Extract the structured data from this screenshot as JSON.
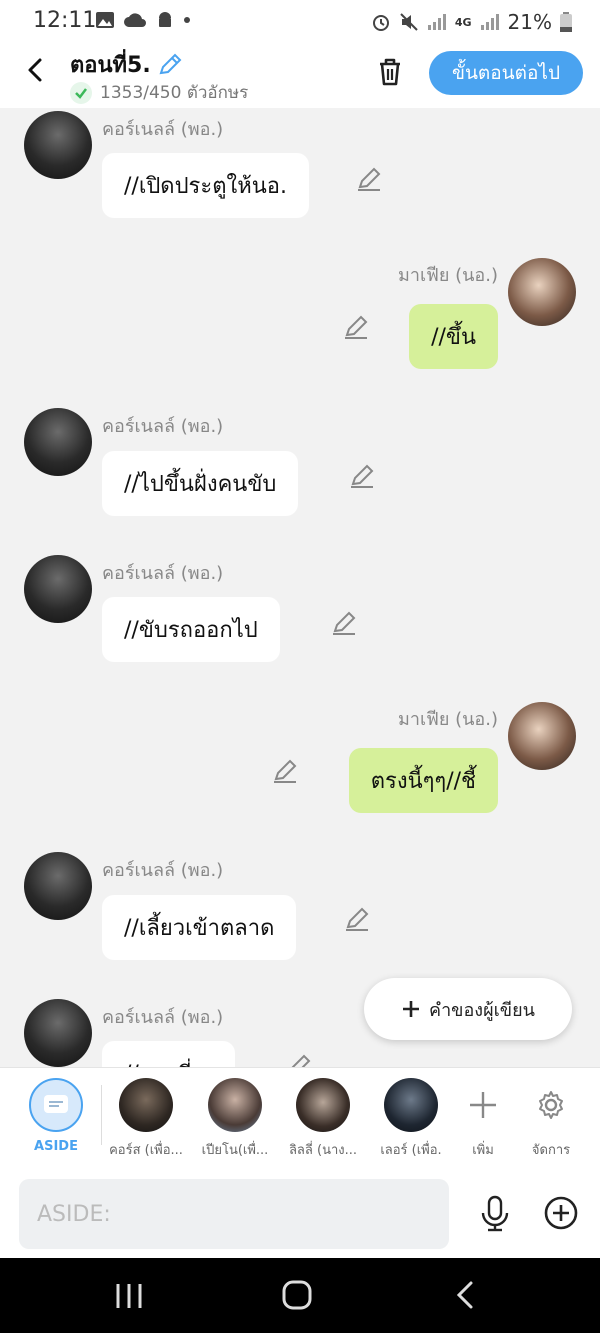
{
  "status": {
    "time": "12:11",
    "battery": "21%",
    "network": "4G"
  },
  "header": {
    "title": "ตอนที่5.",
    "count": "1353/450 ตัวอักษร",
    "next_label": "ขั้นตอนต่อไป"
  },
  "messages": [
    {
      "side": "left",
      "name": "คอร์เนลล์ (พอ.)",
      "text": "//เปิดประตูให้นอ."
    },
    {
      "side": "right",
      "name": "มาเฟีย (นอ.)",
      "text": "//ขึ้น"
    },
    {
      "side": "left",
      "name": "คอร์เนลล์ (พอ.)",
      "text": "//ไปขึ้นฝั่งคนขับ"
    },
    {
      "side": "left",
      "name": "คอร์เนลล์ (พอ.)",
      "text": "//ขับรถออกไป"
    },
    {
      "side": "right",
      "name": "มาเฟีย (นอ.)",
      "text": "ตรงนี้ๆๆ//ชี้"
    },
    {
      "side": "left",
      "name": "คอร์เนลล์ (พอ.)",
      "text": "//เลี้ยวเข้าตลาด"
    },
    {
      "side": "left",
      "name": "คอร์เนลล์ (พอ.)",
      "text": "//แวะที่..."
    }
  ],
  "fab": {
    "label": "คำของผู้เขียน"
  },
  "characters": [
    {
      "label": "ASIDE"
    },
    {
      "label": "คอร์ส (เพื่อ..."
    },
    {
      "label": "เปียโน(เพื่..."
    },
    {
      "label": "ลิลลี่ (นาง..."
    },
    {
      "label": "เลอร์ (เพื่อ."
    },
    {
      "label": "เพิ่ม"
    },
    {
      "label": "จัดการ"
    }
  ],
  "input": {
    "placeholder": "ASIDE:"
  }
}
